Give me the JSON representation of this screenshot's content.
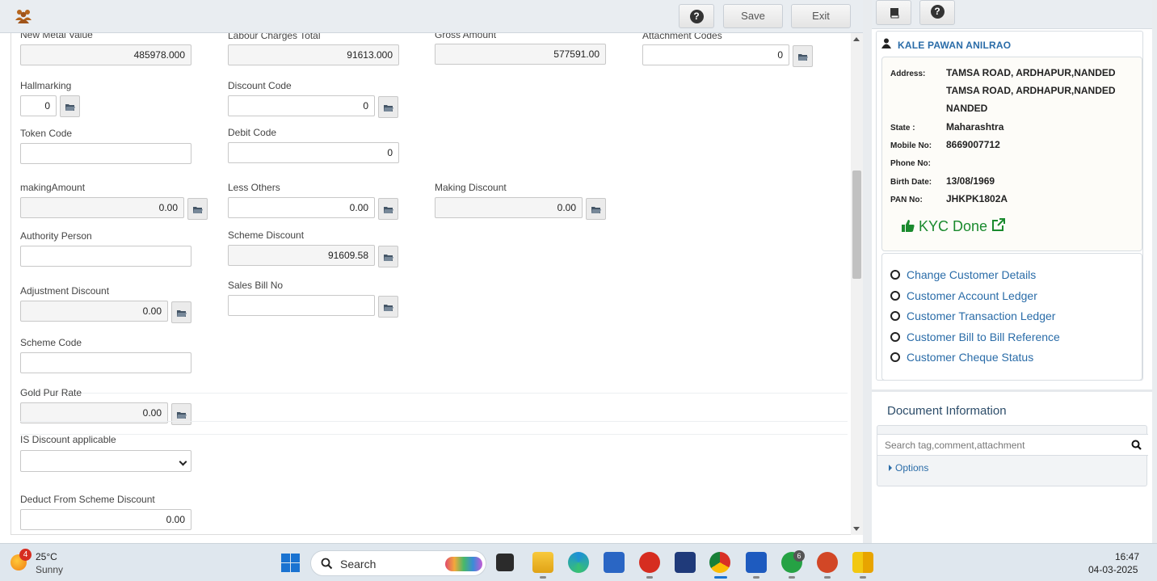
{
  "toolbar": {
    "help_icon": "question-circle-icon",
    "save_label": "Save",
    "exit_label": "Exit"
  },
  "form": {
    "new_metal_value": {
      "label": "New Metal Value",
      "value": "485978.000"
    },
    "labour_charges_total": {
      "label": "Labour Charges Total",
      "value": "91613.000"
    },
    "gross_amount": {
      "label": "Gross Amount",
      "value": "577591.00"
    },
    "attachment_codes": {
      "label": "Attachment Codes",
      "value": "0"
    },
    "hallmarking": {
      "label": "Hallmarking",
      "value": "0"
    },
    "discount_code": {
      "label": "Discount Code",
      "value": "0"
    },
    "token_code": {
      "label": "Token Code",
      "value": ""
    },
    "debit_code": {
      "label": "Debit Code",
      "value": "0"
    },
    "making_amount": {
      "label": "makingAmount",
      "value": "0.00"
    },
    "less_others": {
      "label": "Less Others",
      "value": "0.00"
    },
    "making_discount": {
      "label": "Making Discount",
      "value": "0.00"
    },
    "authority_person": {
      "label": "Authority Person",
      "value": ""
    },
    "scheme_discount": {
      "label": "Scheme Discount",
      "value": "91609.58"
    },
    "adjustment_discount": {
      "label": "Adjustment Discount",
      "value": "0.00"
    },
    "sales_bill_no": {
      "label": "Sales Bill No",
      "value": ""
    },
    "scheme_code": {
      "label": "Scheme Code",
      "value": ""
    },
    "gold_pur_rate": {
      "label": "Gold Pur Rate",
      "value": "0.00"
    },
    "is_discount_applicable": {
      "label": "IS Discount applicable",
      "value": ""
    },
    "deduct_from_scheme_discount": {
      "label": "Deduct From Scheme Discount",
      "value": "0.00"
    }
  },
  "customer": {
    "name": "KALE PAWAN ANILRAO",
    "address_label": "Address:",
    "address_lines": [
      "TAMSA ROAD, ARDHAPUR,NANDED",
      "TAMSA ROAD, ARDHAPUR,NANDED",
      "NANDED"
    ],
    "state_label": "State :",
    "state": "Maharashtra",
    "mobile_label": "Mobile No:",
    "mobile": "8669007712",
    "phone_label": "Phone No:",
    "phone": "",
    "birth_label": "Birth Date:",
    "birth_date": "13/08/1969",
    "pan_label": "PAN No:",
    "pan": "JHKPK1802A",
    "kyc_text": "KYC Done",
    "kyc_color": "#1a8a2e"
  },
  "customer_links": [
    "Change Customer Details",
    "Customer Account Ledger",
    "Customer Transaction Ledger",
    "Customer Bill to Bill Reference",
    "Customer Cheque Status"
  ],
  "documents": {
    "title": "Document Information",
    "search_placeholder": "Search tag,comment,attachment",
    "options_label": "Options"
  },
  "taskbar": {
    "weather_badge": "4",
    "temperature": "25°C",
    "condition": "Sunny",
    "search_label": "Search",
    "whatsapp_badge": "6",
    "time": "16:47",
    "date": "04-03-2025"
  },
  "colors": {
    "link": "#2a6ca8",
    "kyc_green": "#1a8a2e",
    "accent_blue": "#1a73d1"
  }
}
